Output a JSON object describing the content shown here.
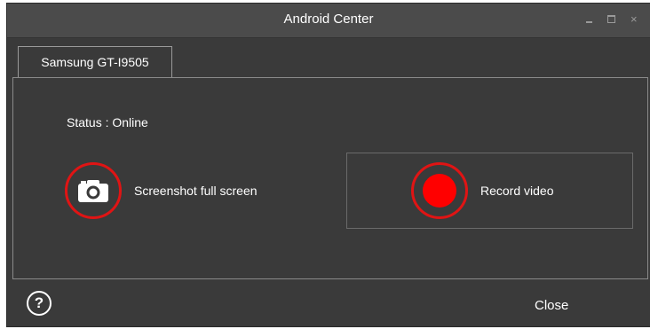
{
  "window": {
    "title": "Android Center",
    "controls": {
      "minimize": "minimize-icon",
      "maximize": "maximize-icon",
      "close": "×"
    }
  },
  "tabs": [
    {
      "label": "Samsung GT-I9505"
    }
  ],
  "main": {
    "status": "Status : Online",
    "actions": {
      "screenshot": {
        "label": "Screenshot full screen",
        "icon": "camera-icon"
      },
      "record": {
        "label": "Record video",
        "icon": "record-icon"
      }
    }
  },
  "footer": {
    "help": "?",
    "close_label": "Close"
  },
  "colors": {
    "accent": "#e01414",
    "record_dot": "#ff0000",
    "background": "#3a3a3a"
  }
}
